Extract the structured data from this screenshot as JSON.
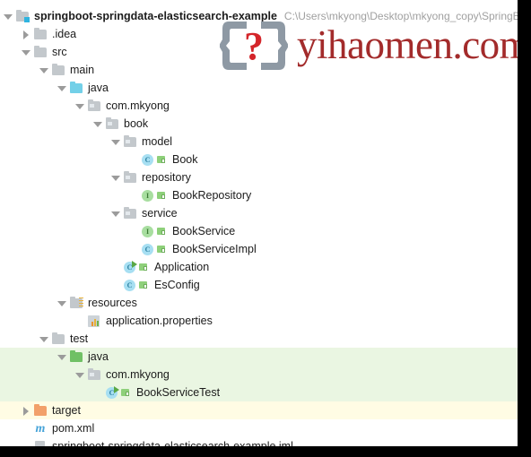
{
  "window": {
    "background": "#ffffff",
    "border_color": "#000000"
  },
  "watermark": {
    "text": "yihaomen.com",
    "logo_glyph": "?",
    "text_color": "#a32b2b",
    "logo_color": "#8e99a4"
  },
  "project_path": "C:\\Users\\mkyong\\Desktop\\mkyong_copy\\SpringBoo",
  "colors": {
    "highlight_green": "#eaf6e2",
    "highlight_yellow": "#fffce4",
    "folder_gray": "#c3c8cc",
    "folder_cyan": "#73d0e8",
    "folder_green": "#70c065",
    "folder_orange": "#f2a06a",
    "class_icon": "#a7dff2",
    "interface_icon": "#a8dea0",
    "maven_icon": "#46a3d8"
  },
  "tree": [
    {
      "label": "springboot-springdata-elasticsearch-example",
      "icon": "module-folder-icon",
      "arrow": "down",
      "depth": 0,
      "bold": true,
      "highlight": "none",
      "path": "C:\\Users\\mkyong\\Desktop\\mkyong_copy\\SpringBoo"
    },
    {
      "label": ".idea",
      "icon": "folder-icon",
      "arrow": "right",
      "depth": 1,
      "bold": false,
      "highlight": "none"
    },
    {
      "label": "src",
      "icon": "folder-icon",
      "arrow": "down",
      "depth": 1,
      "bold": false,
      "highlight": "none"
    },
    {
      "label": "main",
      "icon": "folder-icon",
      "arrow": "down",
      "depth": 2,
      "bold": false,
      "highlight": "none"
    },
    {
      "label": "java",
      "icon": "source-folder-icon",
      "arrow": "down",
      "depth": 3,
      "bold": false,
      "highlight": "none"
    },
    {
      "label": "com.mkyong",
      "icon": "package-icon",
      "arrow": "down",
      "depth": 4,
      "bold": false,
      "highlight": "none"
    },
    {
      "label": "book",
      "icon": "package-icon",
      "arrow": "down",
      "depth": 5,
      "bold": false,
      "highlight": "none"
    },
    {
      "label": "model",
      "icon": "package-icon",
      "arrow": "down",
      "depth": 6,
      "bold": false,
      "highlight": "none"
    },
    {
      "label": "Book",
      "icon": "java-class-icon",
      "arrow": "none",
      "depth": 7,
      "bold": false,
      "highlight": "none"
    },
    {
      "label": "repository",
      "icon": "package-icon",
      "arrow": "down",
      "depth": 6,
      "bold": false,
      "highlight": "none"
    },
    {
      "label": "BookRepository",
      "icon": "java-interface-icon",
      "arrow": "none",
      "depth": 7,
      "bold": false,
      "highlight": "none"
    },
    {
      "label": "service",
      "icon": "package-icon",
      "arrow": "down",
      "depth": 6,
      "bold": false,
      "highlight": "none"
    },
    {
      "label": "BookService",
      "icon": "java-interface-icon",
      "arrow": "none",
      "depth": 7,
      "bold": false,
      "highlight": "none"
    },
    {
      "label": "BookServiceImpl",
      "icon": "java-class-icon",
      "arrow": "none",
      "depth": 7,
      "bold": false,
      "highlight": "none"
    },
    {
      "label": "Application",
      "icon": "java-class-runnable-icon",
      "arrow": "none",
      "depth": 6,
      "bold": false,
      "highlight": "none"
    },
    {
      "label": "EsConfig",
      "icon": "java-class-icon",
      "arrow": "none",
      "depth": 6,
      "bold": false,
      "highlight": "none"
    },
    {
      "label": "resources",
      "icon": "resources-folder-icon",
      "arrow": "down",
      "depth": 3,
      "bold": false,
      "highlight": "none"
    },
    {
      "label": "application.properties",
      "icon": "properties-file-icon",
      "arrow": "none",
      "depth": 4,
      "bold": false,
      "highlight": "none"
    },
    {
      "label": "test",
      "icon": "folder-icon",
      "arrow": "down",
      "depth": 2,
      "bold": false,
      "highlight": "none"
    },
    {
      "label": "java",
      "icon": "test-source-folder-icon",
      "arrow": "down",
      "depth": 3,
      "bold": false,
      "highlight": "green"
    },
    {
      "label": "com.mkyong",
      "icon": "package-icon",
      "arrow": "down",
      "depth": 4,
      "bold": false,
      "highlight": "green"
    },
    {
      "label": "BookServiceTest",
      "icon": "java-class-runnable-icon",
      "arrow": "none",
      "depth": 5,
      "bold": false,
      "highlight": "green"
    },
    {
      "label": "target",
      "icon": "excluded-folder-icon",
      "arrow": "right",
      "depth": 1,
      "bold": false,
      "highlight": "yellow"
    },
    {
      "label": "pom.xml",
      "icon": "maven-file-icon",
      "arrow": "none",
      "depth": 1,
      "bold": false,
      "highlight": "none"
    },
    {
      "label": "springboot-springdata-elasticsearch-example.iml",
      "icon": "module-file-icon",
      "arrow": "none",
      "depth": 1,
      "bold": false,
      "highlight": "none"
    }
  ]
}
